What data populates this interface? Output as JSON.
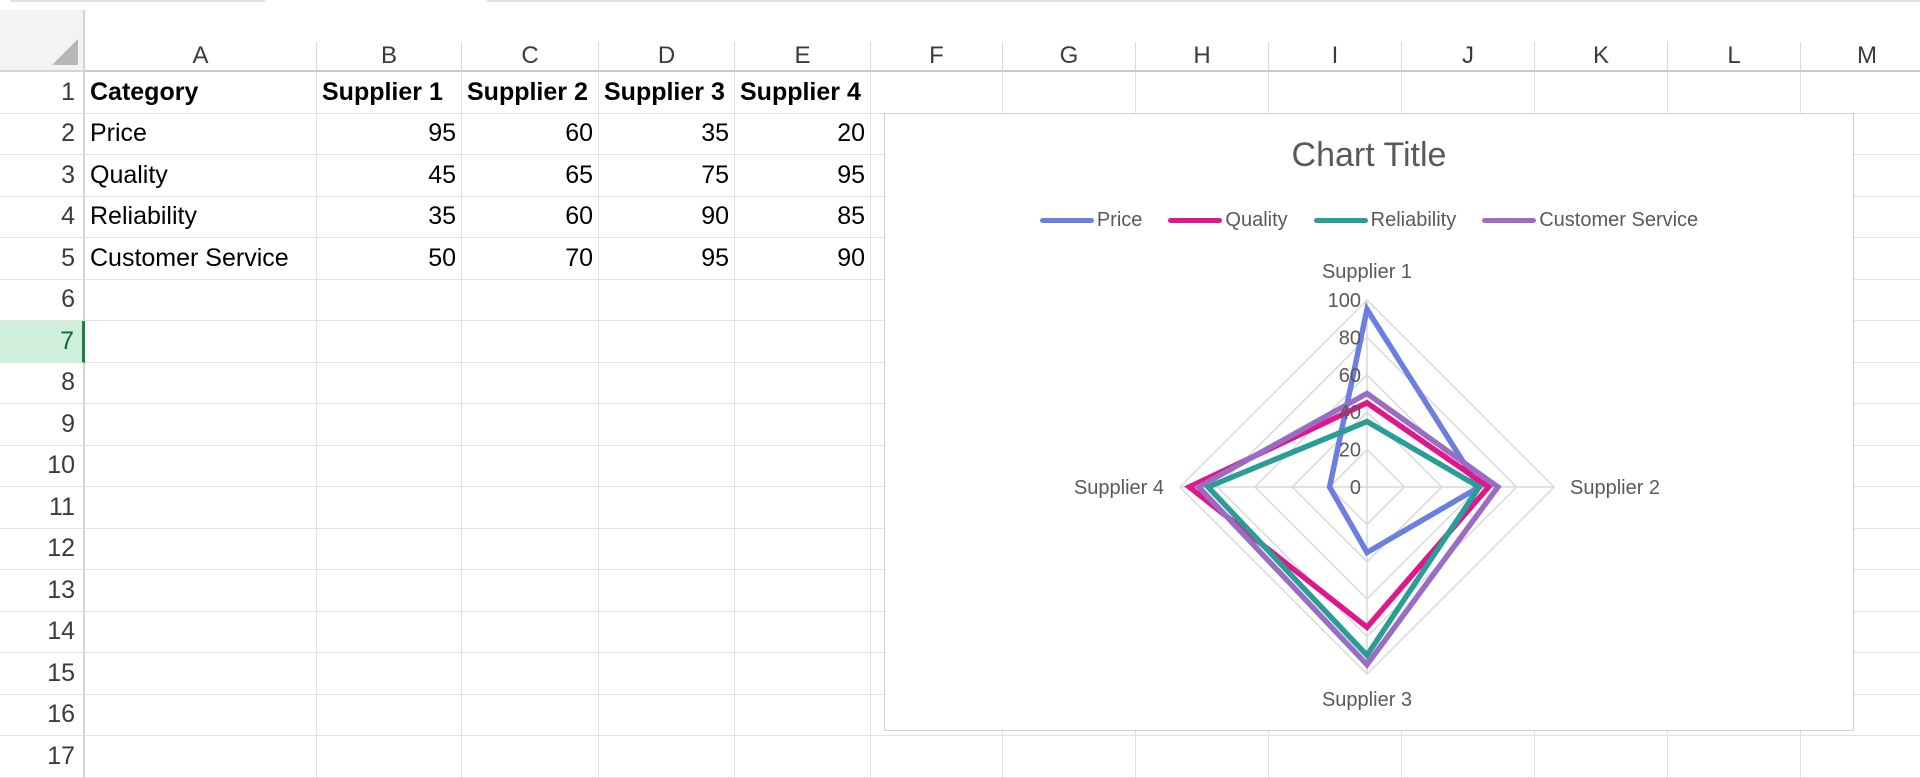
{
  "sheet": {
    "columns": [
      "A",
      "B",
      "C",
      "D",
      "E",
      "F",
      "G",
      "H",
      "I",
      "J",
      "K",
      "L",
      "M"
    ],
    "rows": [
      "1",
      "2",
      "3",
      "4",
      "5",
      "6",
      "7",
      "8",
      "9",
      "10",
      "11",
      "12",
      "13",
      "14",
      "15",
      "16",
      "17"
    ],
    "selected_row": "7",
    "table": {
      "header": [
        "Category",
        "Supplier 1",
        "Supplier 2",
        "Supplier 3",
        "Supplier 4"
      ],
      "rows": [
        [
          "Price",
          "95",
          "60",
          "35",
          "20"
        ],
        [
          "Quality",
          "45",
          "65",
          "75",
          "95"
        ],
        [
          "Reliability",
          "35",
          "60",
          "90",
          "85"
        ],
        [
          "Customer Service",
          "50",
          "70",
          "95",
          "90"
        ]
      ]
    }
  },
  "chart": {
    "title": "Chart Title",
    "colors": {
      "Price": "#6b7fe0",
      "Quality": "#e0168b",
      "Reliability": "#2a9d97",
      "Customer Service": "#9b6cc4"
    }
  },
  "chart_data": {
    "type": "radar",
    "title": "Chart Title",
    "categories": [
      "Supplier 1",
      "Supplier 2",
      "Supplier 3",
      "Supplier 4"
    ],
    "series": [
      {
        "name": "Price",
        "values": [
          95,
          60,
          35,
          20
        ]
      },
      {
        "name": "Quality",
        "values": [
          45,
          65,
          75,
          95
        ]
      },
      {
        "name": "Reliability",
        "values": [
          35,
          60,
          90,
          85
        ]
      },
      {
        "name": "Customer Service",
        "values": [
          50,
          70,
          95,
          90
        ]
      }
    ],
    "r_ticks": [
      "0",
      "20",
      "40",
      "60",
      "80",
      "100"
    ],
    "rlim": [
      0,
      100
    ],
    "grid": true,
    "legend_position": "top"
  }
}
